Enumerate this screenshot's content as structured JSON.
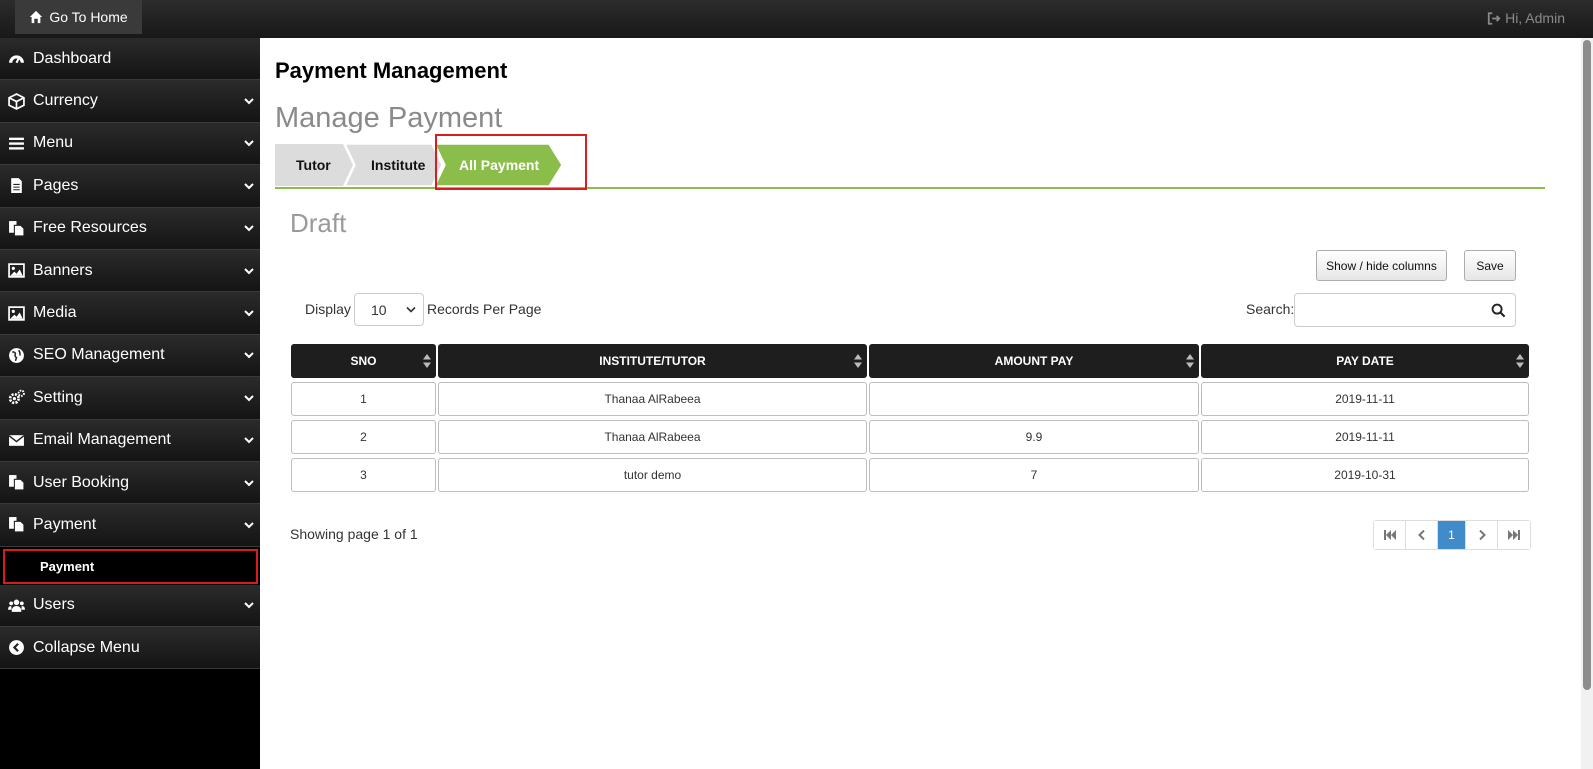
{
  "topbar": {
    "home_label": "Go To Home",
    "admin_label": "Hi, Admin"
  },
  "sidebar": {
    "items": [
      {
        "label": "Dashboard",
        "icon": "dashboard-icon"
      },
      {
        "label": "Currency",
        "icon": "cube-icon"
      },
      {
        "label": "Menu",
        "icon": "bars-icon"
      },
      {
        "label": "Pages",
        "icon": "file-icon"
      },
      {
        "label": "Free Resources",
        "icon": "files-icon"
      },
      {
        "label": "Banners",
        "icon": "image-icon"
      },
      {
        "label": "Media",
        "icon": "image-icon"
      },
      {
        "label": "SEO Management",
        "icon": "globe-icon"
      },
      {
        "label": "Setting",
        "icon": "gears-icon"
      },
      {
        "label": "Email Management",
        "icon": "envelope-icon"
      },
      {
        "label": "User Booking",
        "icon": "files-icon"
      },
      {
        "label": "Payment",
        "icon": "files-icon"
      }
    ],
    "sub_item": "Payment",
    "users_label": "Users",
    "collapse_label": "Collapse Menu"
  },
  "main": {
    "page_title": "Payment Management",
    "sub_title": "Manage Payment",
    "tabs": [
      "Tutor",
      "Institute",
      "All Payment"
    ],
    "section_title": "Draft",
    "show_hide_label": "Show / hide columns",
    "save_label": "Save",
    "display_label": "Display",
    "per_page_value": "10",
    "records_label": "Records Per Page",
    "search_label": "Search:",
    "search_value": "",
    "table": {
      "headers": [
        "SNO",
        "INSTITUTE/TUTOR",
        "AMOUNT PAY",
        "PAY DATE"
      ],
      "rows": [
        [
          "1",
          "Thanaa AlRabeea",
          "",
          "2019-11-11"
        ],
        [
          "2",
          "Thanaa AlRabeea",
          "9.9",
          "2019-11-11"
        ],
        [
          "3",
          "tutor demo",
          "7",
          "2019-10-31"
        ]
      ]
    },
    "showing_text": "Showing page 1 of 1",
    "current_page": "1"
  },
  "colors": {
    "accent_green": "#8bbd4a",
    "pager_active": "#428bca",
    "highlight_red": "#d91c1c"
  }
}
